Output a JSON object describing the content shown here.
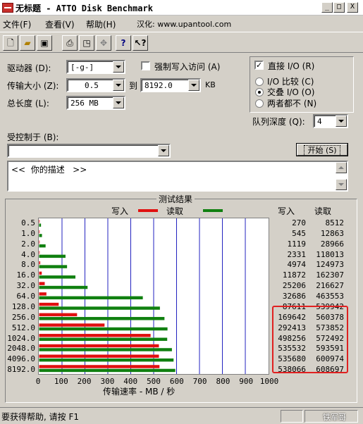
{
  "window": {
    "title": "无标题 - ATTO Disk Benchmark",
    "controls": {
      "minimize": "_",
      "maximize": "□",
      "close": "X"
    }
  },
  "menu": {
    "file": "文件(F)",
    "view": "查看(V)",
    "help": "帮助(H)",
    "localize": "汉化: www.upantool.com"
  },
  "toolbar": {
    "icons": [
      "new-doc-icon",
      "open-folder-icon",
      "save-icon",
      "print-icon",
      "print-preview-icon",
      "move-icon",
      "help-icon",
      "context-help-icon"
    ]
  },
  "settings": {
    "drive_label": "驱动器 (D):",
    "drive_value": "[-g-]",
    "force_write_label": "强制写入访问 (A)",
    "direct_io_label": "直接 I/O (R)",
    "transfer_size_label": "传输大小 (Z):",
    "transfer_from": "0.5",
    "to_label": "到",
    "transfer_to": "8192.0",
    "kb_label": "KB",
    "total_length_label": "总长度 (L):",
    "total_length_value": "256 MB",
    "io_compare_label": "I/O 比较 (C)",
    "overlapped_io_label": "交叠 I/O (O)",
    "neither_label": "两者都不 (N)",
    "queue_depth_label": "队列深度 (Q):",
    "queue_depth_value": "4",
    "controlled_by_label": "受控制于 (B):",
    "controlled_by_value": "",
    "start_button": "开始 (S)",
    "description_text": "<<  你的描述   >>"
  },
  "results": {
    "title": "测试结果",
    "legend_write": "写入",
    "legend_read": "读取",
    "col_write": "写入",
    "col_read": "读取",
    "x_axis_label": "传输速率 - MB / 秒",
    "x_ticks": [
      "0",
      "100",
      "200",
      "300",
      "400",
      "500",
      "600",
      "700",
      "800",
      "900",
      "1000"
    ]
  },
  "chart_data": {
    "type": "bar",
    "orientation": "horizontal",
    "title": "测试结果",
    "xlabel": "传输速率 - MB / 秒",
    "ylabel": "",
    "xlim": [
      0,
      1000
    ],
    "categories": [
      "0.5",
      "1.0",
      "2.0",
      "4.0",
      "8.0",
      "16.0",
      "32.0",
      "64.0",
      "128.0",
      "256.0",
      "512.0",
      "1024.0",
      "2048.0",
      "4096.0",
      "8192.0"
    ],
    "series": [
      {
        "name": "写入",
        "color": "#e01010",
        "values": [
          0.3,
          0.5,
          1.1,
          2.3,
          4.9,
          11.6,
          24.6,
          31.9,
          85.6,
          165.7,
          285.6,
          486.6,
          523.0,
          523.1,
          525.5
        ],
        "labels": [
          "270",
          "545",
          "1119",
          "2331",
          "4974",
          "11872",
          "25206",
          "32686",
          "87611",
          "169642",
          "292413",
          "498256",
          "535532",
          "535680",
          "538066"
        ]
      },
      {
        "name": "读取",
        "color": "#108010",
        "values": [
          8.3,
          12.6,
          28.3,
          115.3,
          122.0,
          158.5,
          211.6,
          452.7,
          527.3,
          547.2,
          560.4,
          559.1,
          579.7,
          586.9,
          594.4
        ],
        "labels": [
          "8512",
          "12863",
          "28966",
          "118013",
          "124973",
          "162307",
          "216627",
          "463553",
          "539942",
          "560378",
          "573852",
          "572492",
          "593591",
          "600974",
          "608697"
        ]
      }
    ],
    "grid": true,
    "legend": "top"
  },
  "status": {
    "help_text": "要获得帮助, 请按 F1",
    "watermark": "铁军哥"
  }
}
